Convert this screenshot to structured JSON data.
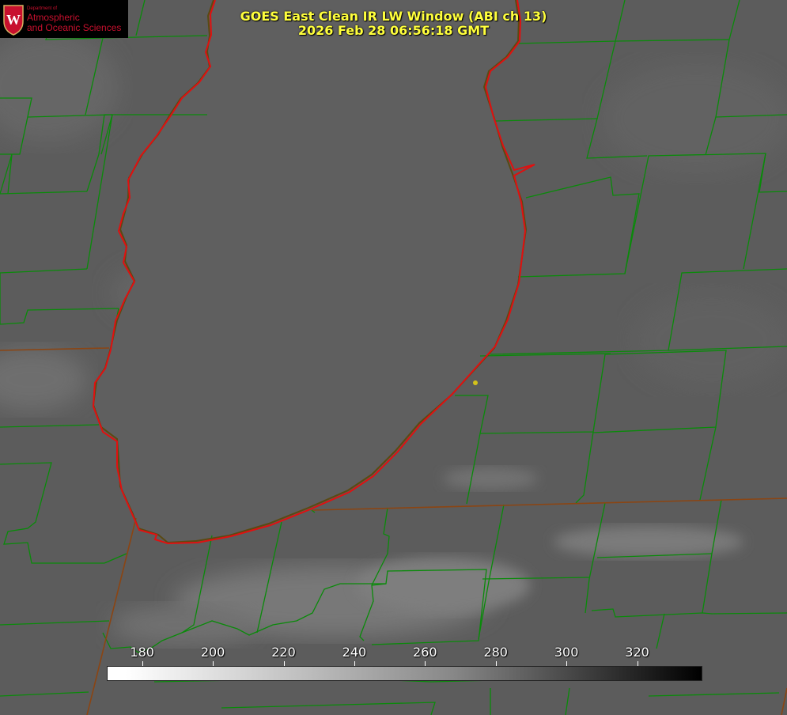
{
  "title": {
    "line1": "GOES East Clean IR LW Window (ABI ch 13)",
    "line2": "2026 Feb 28 06:56:18 GMT"
  },
  "logo": {
    "dept": "Department of",
    "line1": "Atmospheric",
    "line2": "and Oceanic Sciences",
    "crest_letter": "W"
  },
  "colorbar": {
    "min": 170,
    "max": 338,
    "ticks": [
      "180",
      "200",
      "220",
      "240",
      "260",
      "280",
      "300",
      "320"
    ]
  },
  "colors": {
    "title": "#ffff3c",
    "county_lines": "#0a8a0a",
    "state_lines": "#8b4513",
    "shoreline": "#e01010",
    "marker": "#d4c21a"
  }
}
